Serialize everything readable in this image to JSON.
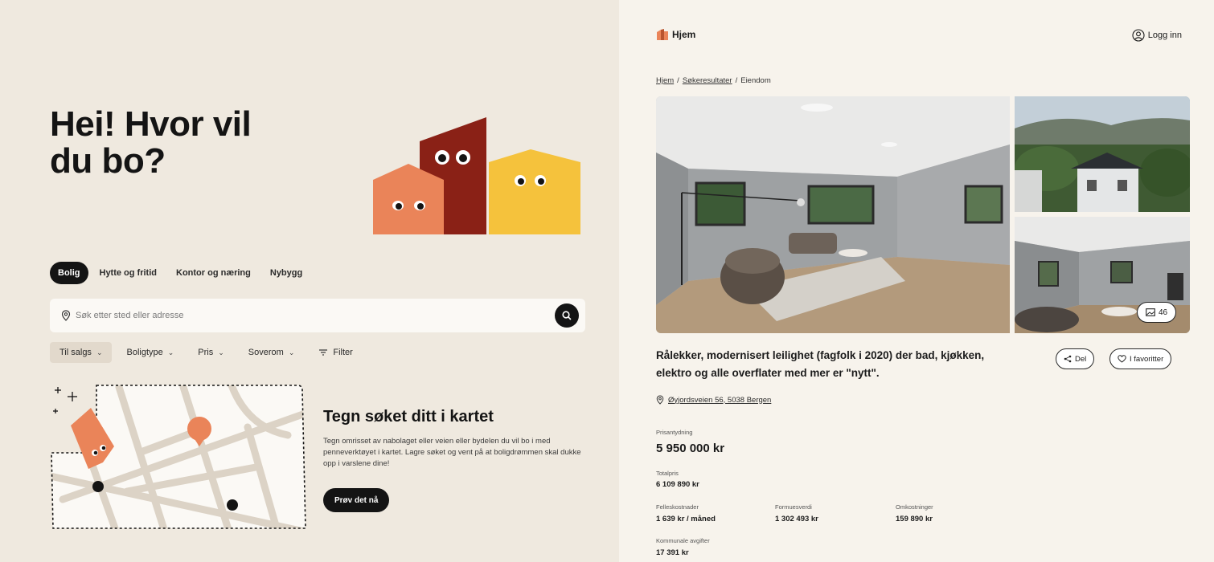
{
  "search_page": {
    "hero_title": "Hei! Hvor vil du bo?",
    "tabs": [
      {
        "label": "Bolig",
        "active": true
      },
      {
        "label": "Hytte og fritid",
        "active": false
      },
      {
        "label": "Kontor og næring",
        "active": false
      },
      {
        "label": "Nybygg",
        "active": false
      }
    ],
    "search": {
      "placeholder": "Søk etter sted eller adresse"
    },
    "filters": [
      {
        "label": "Til salgs",
        "has_chevron": true,
        "active": true
      },
      {
        "label": "Boligtype",
        "has_chevron": true,
        "active": false
      },
      {
        "label": "Pris",
        "has_chevron": true,
        "active": false
      },
      {
        "label": "Soverom",
        "has_chevron": true,
        "active": false
      },
      {
        "label": "Filter",
        "has_chevron": false,
        "active": false
      }
    ],
    "draw_section": {
      "title": "Tegn søket ditt i kartet",
      "text": "Tegn omrisset av nabolaget eller veien eller bydelen du vil bo i med penneverktøyet i kartet. Lagre søket og vent på at boligdrømmen skal dukke opp i varslene dine!",
      "button": "Prøv det nå"
    },
    "colors": {
      "orange": "#ea8459",
      "red": "#8a2116",
      "yellow": "#f5c23c",
      "dark": "#141414"
    }
  },
  "listing_page": {
    "logo_text": "Hjem",
    "login_label": "Logg inn",
    "breadcrumb": [
      {
        "label": "Hjem",
        "link": true
      },
      {
        "label": "Søkeresultater",
        "link": true
      },
      {
        "label": "Eiendom",
        "link": false
      }
    ],
    "photo_count": "46",
    "title": "Rålekker, modernisert leilighet (fagfolk i 2020) der bad, kjøkken, elektro og alle overflater med mer er \"nytt\".",
    "share_label": "Del",
    "favorite_label": "I favoritter",
    "address": "Øyjordsveien 56, 5038 Bergen",
    "prices": {
      "asking_label": "Prisantydning",
      "asking_value": "5 950 000 kr",
      "total_label": "Totalpris",
      "total_value": "6 109 890 kr",
      "shared_cost_label": "Felleskostnader",
      "shared_cost_value": "1 639 kr / måned",
      "wealth_label": "Formuesverdi",
      "wealth_value": "1 302 493 kr",
      "fees_label": "Omkostninger",
      "fees_value": "159 890 kr",
      "municipal_label": "Kommunale avgifter",
      "municipal_value": "17 391 kr"
    }
  }
}
